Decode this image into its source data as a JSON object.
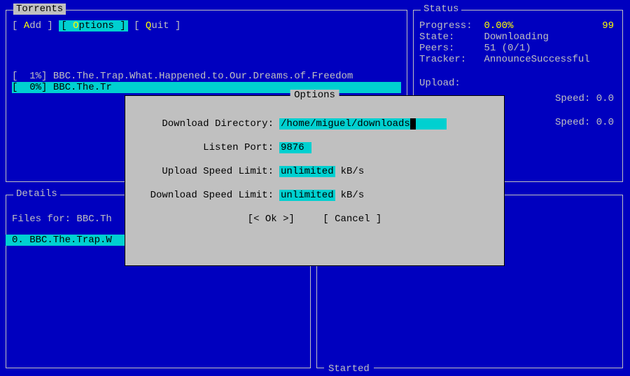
{
  "torrents_panel": {
    "title": "Torrents",
    "menu": {
      "add": {
        "pre": "A",
        "rest": "dd"
      },
      "options": {
        "pre": "O",
        "rest": "ptions"
      },
      "quit": {
        "pre": "Q",
        "rest": "uit"
      }
    },
    "list": [
      {
        "pct": "[  1%]",
        "name": "BBC.The.Trap.What.Happened.to.Our.Dreams.of.Freedom",
        "selected": false
      },
      {
        "pct": "[  0%]",
        "name": "BBC.The.Tr",
        "selected": true
      }
    ]
  },
  "status_panel": {
    "title": "Status",
    "progress_label": "Progress:",
    "progress_value": "0.00%",
    "right_number": "99",
    "state_label": "State:",
    "state_value": "Downloading",
    "peers_label": "Peers:",
    "peers_value": "51 (0/1)",
    "tracker_label": "Tracker:",
    "tracker_value": "AnnounceSuccessful",
    "upload_label": "Upload:",
    "speed1_label": "Speed:",
    "speed1_value": "0.0",
    "speed2_label": "Speed:",
    "speed2_value": "0.0"
  },
  "details_panel": {
    "title": "Details",
    "files_for_prefix": "Files for:",
    "files_for_name": "BBC.Th",
    "file_row": "0. BBC.The.Trap.W"
  },
  "started_panel": {
    "bottom_label": "Started"
  },
  "options_dialog": {
    "title": "Options",
    "download_dir_label": "Download Directory:",
    "download_dir_value": "/home/miguel/downloads",
    "download_dir_extra_spaces": "     ",
    "listen_port_label": "Listen Port:",
    "listen_port_value": "9876 ",
    "upload_limit_label": "Upload Speed Limit:",
    "upload_limit_value": "unlimited",
    "download_limit_label": "Download Speed Limit:",
    "download_limit_value": "unlimited",
    "unit": "kB/s",
    "ok_label": "[< Ok >]",
    "cancel_label": "[ Cancel ]"
  }
}
